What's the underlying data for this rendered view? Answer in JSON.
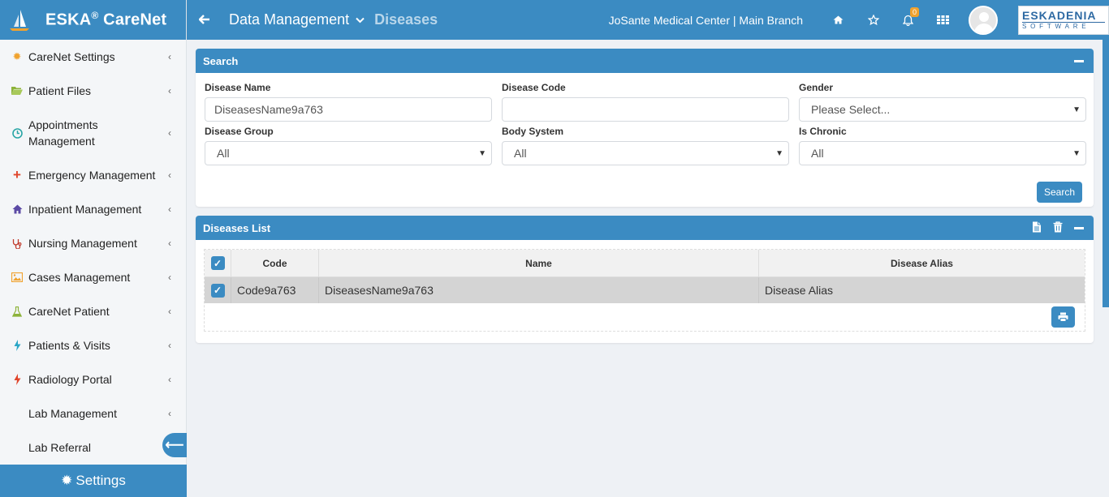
{
  "brand": {
    "name": "ESKA",
    "reg": "®",
    "product": " CareNet"
  },
  "sidebar": {
    "items": [
      {
        "label": "CareNet Settings",
        "icon": "gear-icon",
        "color": "#f0a22e"
      },
      {
        "label": "Patient Files",
        "icon": "folder-open-icon",
        "color": "#8db33a"
      },
      {
        "label": "Appointments Management",
        "icon": "clock-icon",
        "color": "#2aa6a6"
      },
      {
        "label": "Emergency Management",
        "icon": "plus-icon",
        "color": "#e0452b"
      },
      {
        "label": "Inpatient Management",
        "icon": "home-icon",
        "color": "#5b4aa5"
      },
      {
        "label": "Nursing Management",
        "icon": "stethoscope-icon",
        "color": "#c0392b"
      },
      {
        "label": "Cases Management",
        "icon": "image-icon",
        "color": "#f0a22e"
      },
      {
        "label": "CareNet Patient",
        "icon": "flask-icon",
        "color": "#8db33a"
      },
      {
        "label": "Patients & Visits",
        "icon": "bolt-icon",
        "color": "#2aa6c6"
      },
      {
        "label": "Radiology Portal",
        "icon": "bolt-icon",
        "color": "#e0452b"
      },
      {
        "label": "Lab Management",
        "icon": "",
        "color": ""
      },
      {
        "label": "Lab Referral",
        "icon": "",
        "color": ""
      }
    ],
    "settings_label": "Settings"
  },
  "header": {
    "breadcrumb_main": "Data Management",
    "breadcrumb_sub": "Diseases",
    "branch": "JoSante Medical Center | Main Branch",
    "notification_count": "0",
    "logo_line1": "ESKADENIA",
    "logo_line2": "SOFTWARE"
  },
  "search": {
    "title": "Search",
    "fields": {
      "disease_name": {
        "label": "Disease Name",
        "value": "DiseasesName9a763"
      },
      "disease_code": {
        "label": "Disease Code",
        "value": ""
      },
      "gender": {
        "label": "Gender",
        "value": "Please Select..."
      },
      "disease_group": {
        "label": "Disease Group",
        "value": "All"
      },
      "body_system": {
        "label": "Body System",
        "value": "All"
      },
      "is_chronic": {
        "label": "Is Chronic",
        "value": "All"
      }
    },
    "button": "Search"
  },
  "list": {
    "title": "Diseases List",
    "columns": {
      "code": "Code",
      "name": "Name",
      "alias": "Disease Alias"
    },
    "rows": [
      {
        "code": "Code9a763",
        "name": "DiseasesName9a763",
        "alias": "Disease Alias",
        "checked": true
      }
    ]
  },
  "colors": {
    "primary": "#3b8bc2",
    "selected_row": "#d4d4d4",
    "badge": "#f0a22e"
  }
}
